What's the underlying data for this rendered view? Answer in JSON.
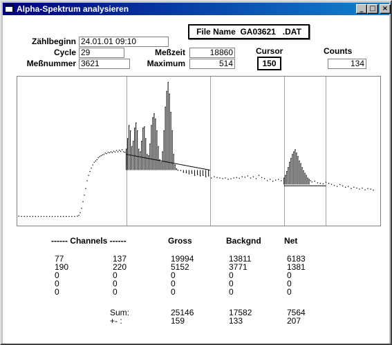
{
  "window": {
    "title": "Alpha-Spektrum analysieren",
    "buttons": {
      "minimize": "_",
      "maximize": "□",
      "close": "×"
    }
  },
  "file": {
    "label": "File Name",
    "value": "GA03621   .DAT"
  },
  "fields": {
    "zaehlbeginn": {
      "label": "Zählbeginn",
      "value": "24.01.01 09:10"
    },
    "cycle": {
      "label": "Cycle",
      "value": "29"
    },
    "messnummer": {
      "label": "Meßnummer",
      "value": "3621"
    },
    "messzeit": {
      "label": "Meßzeit",
      "value": "18860"
    },
    "maximum": {
      "label": "Maximum",
      "value": "514"
    },
    "cursor": {
      "label": "Cursor",
      "value": "150"
    },
    "counts": {
      "label": "Counts",
      "value": "134"
    }
  },
  "chart_data": {
    "type": "scatter",
    "title": "",
    "xlim": [
      0,
      255
    ],
    "ylim": [
      0,
      520
    ],
    "region_markers": [
      77,
      137,
      190,
      220
    ],
    "baseline_lines": [
      {
        "x1": 77,
        "y1": 240,
        "x2": 137,
        "y2": 180
      },
      {
        "x1": 190,
        "y1": 120,
        "x2": 220,
        "y2": 120
      }
    ],
    "points": [
      [
        0,
        5
      ],
      [
        2,
        4
      ],
      [
        4,
        4
      ],
      [
        6,
        4
      ],
      [
        8,
        4
      ],
      [
        10,
        4
      ],
      [
        12,
        4
      ],
      [
        14,
        4
      ],
      [
        16,
        4
      ],
      [
        18,
        4
      ],
      [
        20,
        4
      ],
      [
        22,
        4
      ],
      [
        24,
        4
      ],
      [
        26,
        4
      ],
      [
        28,
        4
      ],
      [
        30,
        4
      ],
      [
        32,
        4
      ],
      [
        34,
        4
      ],
      [
        36,
        4
      ],
      [
        38,
        4
      ],
      [
        40,
        4
      ],
      [
        42,
        5
      ],
      [
        43,
        8
      ],
      [
        44,
        18
      ],
      [
        45,
        35
      ],
      [
        46,
        60
      ],
      [
        47,
        85
      ],
      [
        48,
        110
      ],
      [
        49,
        140
      ],
      [
        50,
        160
      ],
      [
        51,
        175
      ],
      [
        52,
        188
      ],
      [
        53,
        200
      ],
      [
        54,
        210
      ],
      [
        55,
        215
      ],
      [
        56,
        220
      ],
      [
        57,
        228
      ],
      [
        58,
        232
      ],
      [
        59,
        235
      ],
      [
        60,
        238
      ],
      [
        61,
        240
      ],
      [
        62,
        245
      ],
      [
        63,
        243
      ],
      [
        64,
        248
      ],
      [
        65,
        246
      ],
      [
        66,
        250
      ],
      [
        67,
        247
      ],
      [
        68,
        252
      ],
      [
        69,
        249
      ],
      [
        70,
        255
      ],
      [
        71,
        250
      ],
      [
        72,
        256
      ],
      [
        73,
        252
      ],
      [
        74,
        258
      ],
      [
        75,
        250
      ],
      [
        76,
        248
      ],
      [
        77,
        260
      ],
      [
        78,
        300
      ],
      [
        79,
        350
      ],
      [
        80,
        330
      ],
      [
        81,
        270
      ],
      [
        82,
        290
      ],
      [
        83,
        340
      ],
      [
        84,
        360
      ],
      [
        85,
        330
      ],
      [
        86,
        260
      ],
      [
        87,
        250
      ],
      [
        88,
        290
      ],
      [
        89,
        340
      ],
      [
        90,
        345
      ],
      [
        91,
        300
      ],
      [
        92,
        240
      ],
      [
        93,
        235
      ],
      [
        94,
        280
      ],
      [
        95,
        350
      ],
      [
        96,
        380
      ],
      [
        97,
        395
      ],
      [
        98,
        375
      ],
      [
        99,
        330
      ],
      [
        100,
        270
      ],
      [
        101,
        220
      ],
      [
        102,
        210
      ],
      [
        103,
        250
      ],
      [
        104,
        330
      ],
      [
        105,
        420
      ],
      [
        106,
        480
      ],
      [
        107,
        514
      ],
      [
        108,
        470
      ],
      [
        109,
        400
      ],
      [
        110,
        330
      ],
      [
        111,
        240
      ],
      [
        112,
        200
      ],
      [
        113,
        185
      ],
      [
        114,
        180
      ],
      [
        116,
        178
      ],
      [
        118,
        172
      ],
      [
        120,
        170
      ],
      [
        122,
        166
      ],
      [
        124,
        168
      ],
      [
        126,
        160
      ],
      [
        128,
        163
      ],
      [
        130,
        158
      ],
      [
        132,
        160
      ],
      [
        134,
        155
      ],
      [
        136,
        158
      ],
      [
        138,
        150
      ],
      [
        140,
        155
      ],
      [
        142,
        152
      ],
      [
        144,
        150
      ],
      [
        146,
        148
      ],
      [
        148,
        150
      ],
      [
        150,
        145
      ],
      [
        152,
        147
      ],
      [
        154,
        150
      ],
      [
        156,
        152
      ],
      [
        158,
        149
      ],
      [
        160,
        155
      ],
      [
        162,
        153
      ],
      [
        164,
        158
      ],
      [
        166,
        150
      ],
      [
        168,
        155
      ],
      [
        170,
        148
      ],
      [
        172,
        160
      ],
      [
        174,
        152
      ],
      [
        176,
        148
      ],
      [
        178,
        140
      ],
      [
        180,
        145
      ],
      [
        182,
        138
      ],
      [
        184,
        142
      ],
      [
        186,
        145
      ],
      [
        188,
        140
      ],
      [
        190,
        150
      ],
      [
        191,
        160
      ],
      [
        192,
        175
      ],
      [
        193,
        190
      ],
      [
        194,
        210
      ],
      [
        195,
        225
      ],
      [
        196,
        240
      ],
      [
        197,
        250
      ],
      [
        198,
        258
      ],
      [
        199,
        245
      ],
      [
        200,
        232
      ],
      [
        201,
        215
      ],
      [
        202,
        205
      ],
      [
        203,
        190
      ],
      [
        204,
        178
      ],
      [
        205,
        168
      ],
      [
        206,
        160
      ],
      [
        207,
        150
      ],
      [
        208,
        145
      ],
      [
        209,
        140
      ],
      [
        210,
        135
      ],
      [
        212,
        138
      ],
      [
        214,
        132
      ],
      [
        216,
        130
      ],
      [
        218,
        128
      ],
      [
        220,
        134
      ],
      [
        222,
        130
      ],
      [
        224,
        126
      ],
      [
        226,
        122
      ],
      [
        228,
        118
      ],
      [
        230,
        125
      ],
      [
        232,
        120
      ],
      [
        234,
        115
      ],
      [
        236,
        118
      ],
      [
        238,
        110
      ],
      [
        240,
        115
      ],
      [
        242,
        112
      ],
      [
        244,
        108
      ],
      [
        246,
        112
      ],
      [
        248,
        105
      ],
      [
        250,
        110
      ],
      [
        252,
        108
      ],
      [
        254,
        104
      ]
    ]
  },
  "table": {
    "headers": [
      "------ Channels ------",
      "Gross",
      "Backgnd",
      "Net"
    ],
    "rows": [
      [
        "77",
        "137",
        "19994",
        "13811",
        "6183"
      ],
      [
        "190",
        "220",
        "5152",
        "3771",
        "1381"
      ],
      [
        "0",
        "0",
        "0",
        "0",
        "0"
      ],
      [
        "0",
        "0",
        "0",
        "0",
        "0"
      ],
      [
        "0",
        "0",
        "0",
        "0",
        "0"
      ]
    ],
    "sum": {
      "label": "Sum:",
      "gross": "25146",
      "backgnd": "17582",
      "net": "7564"
    },
    "error": {
      "label": "+- :",
      "gross": "159",
      "backgnd": "133",
      "net": "207"
    }
  }
}
